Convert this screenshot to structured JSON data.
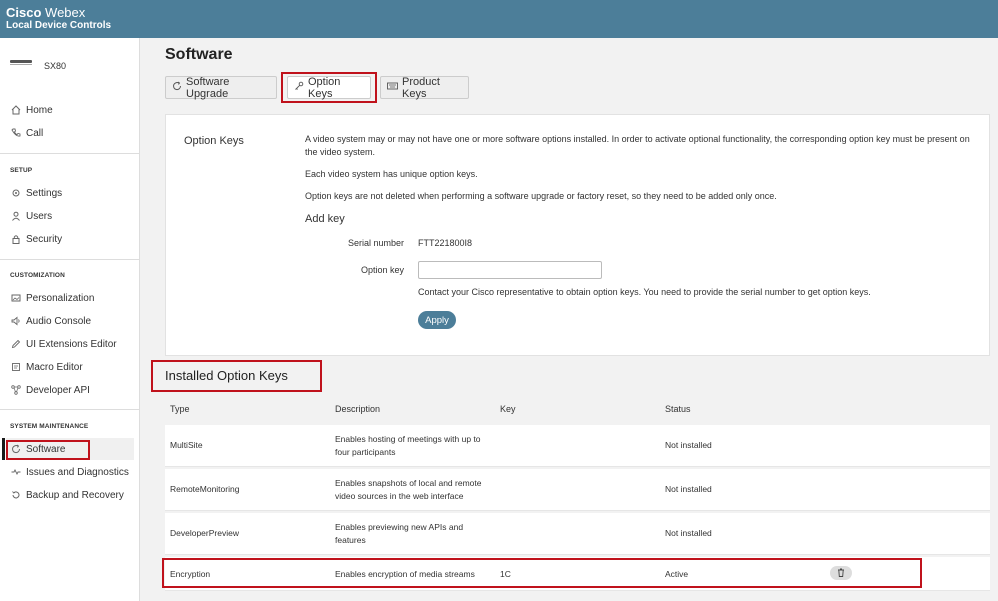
{
  "header": {
    "brand_bold": "Cisco",
    "brand_light": "Webex",
    "subtitle": "Local Device Controls"
  },
  "device": {
    "name": "SX80"
  },
  "sidebar": {
    "top_items": [
      {
        "label": "Home",
        "icon": "home-icon"
      },
      {
        "label": "Call",
        "icon": "phone-icon"
      }
    ],
    "sections": [
      {
        "title": "SETUP",
        "items": [
          {
            "label": "Settings",
            "icon": "gear-icon"
          },
          {
            "label": "Users",
            "icon": "user-icon"
          },
          {
            "label": "Security",
            "icon": "lock-icon"
          }
        ]
      },
      {
        "title": "CUSTOMIZATION",
        "items": [
          {
            "label": "Personalization",
            "icon": "image-icon"
          },
          {
            "label": "Audio Console",
            "icon": "audio-icon"
          },
          {
            "label": "UI Extensions Editor",
            "icon": "pencil-icon"
          },
          {
            "label": "Macro Editor",
            "icon": "macro-icon"
          },
          {
            "label": "Developer API",
            "icon": "network-icon"
          }
        ]
      },
      {
        "title": "SYSTEM MAINTENANCE",
        "items": [
          {
            "label": "Software",
            "icon": "software-icon"
          },
          {
            "label": "Issues and Diagnostics",
            "icon": "pulse-icon"
          },
          {
            "label": "Backup and Recovery",
            "icon": "backup-icon"
          }
        ]
      }
    ]
  },
  "main": {
    "title": "Software",
    "tabs": [
      {
        "label": "Software Upgrade",
        "icon": "refresh-icon"
      },
      {
        "label": "Option Keys",
        "icon": "key-icon"
      },
      {
        "label": "Product Keys",
        "icon": "keyboard-icon"
      }
    ],
    "option_keys": {
      "label": "Option Keys",
      "para1": "A video system may or may not have one or more software options installed. In order to activate optional functionality, the corresponding option key must be present on the video system.",
      "para2": "Each video system has unique option keys.",
      "para3": "Option keys are not deleted when performing a software upgrade or factory reset, so they need to be added only once.",
      "add_key": "Add key",
      "serial_label": "Serial number",
      "serial_value": "FTT221800I8",
      "option_key_label": "Option key",
      "option_key_value": "",
      "help": "Contact your Cisco representative to obtain option keys. You need to provide the serial number to get option keys.",
      "apply": "Apply"
    },
    "installed": {
      "heading": "Installed Option Keys",
      "columns": [
        "Type",
        "Description",
        "Key",
        "Status"
      ],
      "rows": [
        {
          "type": "MultiSite",
          "description": "Enables hosting of meetings with up to four participants",
          "key": "",
          "status": "Not installed"
        },
        {
          "type": "RemoteMonitoring",
          "description": "Enables snapshots of local and remote video sources in the web interface",
          "key": "",
          "status": "Not installed"
        },
        {
          "type": "DeveloperPreview",
          "description": "Enables previewing new APIs and features",
          "key": "",
          "status": "Not installed"
        },
        {
          "type": "Encryption",
          "description": "Enables encryption of media streams",
          "key": "1C",
          "status": "Active"
        }
      ]
    }
  },
  "colors": {
    "header": "#4c7e99",
    "accent": "#4c7e99",
    "highlight": "#c0121c"
  }
}
